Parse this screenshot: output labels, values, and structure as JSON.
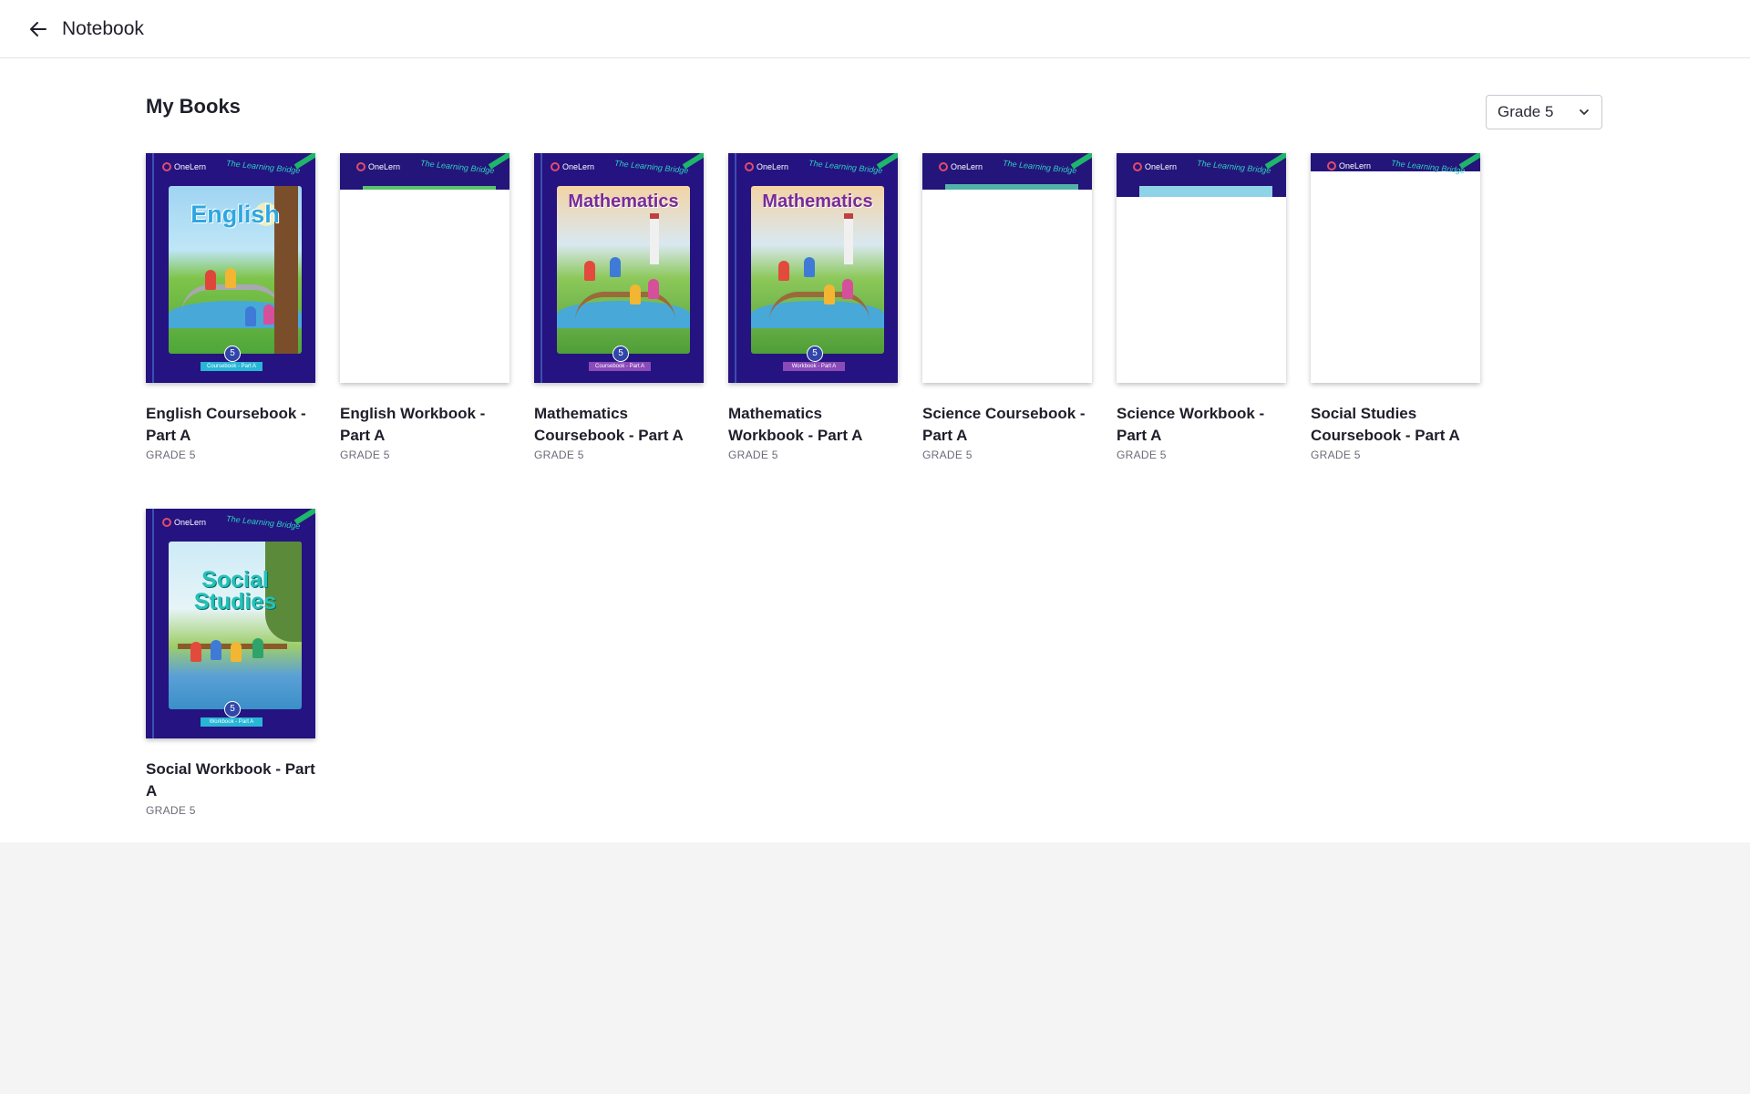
{
  "header": {
    "title": "Notebook",
    "back_icon": "arrow-left-icon"
  },
  "main": {
    "section_title": "My Books",
    "grade_select": {
      "value": "Grade 5",
      "icon": "chevron-down-icon"
    }
  },
  "cover_branding": {
    "logo": "OneLern",
    "tagline": "The Learning Bridge"
  },
  "books": [
    {
      "title": "English Coursebook - Part A",
      "grade": "GRADE 5",
      "cover": "English",
      "cover_state": "loaded",
      "ribbon": "Coursebook - Part A",
      "number": "5"
    },
    {
      "title": "English Workbook - Part A",
      "grade": "GRADE 5",
      "cover": "",
      "cover_state": "loading"
    },
    {
      "title": "Mathematics Coursebook - Part A",
      "grade": "GRADE 5",
      "cover": "Mathematics",
      "cover_state": "loaded",
      "ribbon": "Coursebook - Part A",
      "number": "5"
    },
    {
      "title": "Mathematics Workbook - Part A",
      "grade": "GRADE 5",
      "cover": "Mathematics",
      "cover_state": "loaded",
      "ribbon": "Workbook - Part A",
      "number": "5"
    },
    {
      "title": "Science Coursebook - Part A",
      "grade": "GRADE 5",
      "cover": "",
      "cover_state": "loading"
    },
    {
      "title": "Science Workbook - Part A",
      "grade": "GRADE 5",
      "cover": "",
      "cover_state": "loading"
    },
    {
      "title": "Social Studies Coursebook - Part A",
      "grade": "GRADE 5",
      "cover": "",
      "cover_state": "loading"
    },
    {
      "title": "Social Workbook - Part A",
      "grade": "GRADE 5",
      "cover": "Social Studies",
      "cover_state": "loaded",
      "ribbon": "Workbook - Part A",
      "number": "5"
    }
  ],
  "colors": {
    "cover_bg": "#241380",
    "accent_teal": "#2ed0c0",
    "page_bg": "#f4f4f4"
  }
}
